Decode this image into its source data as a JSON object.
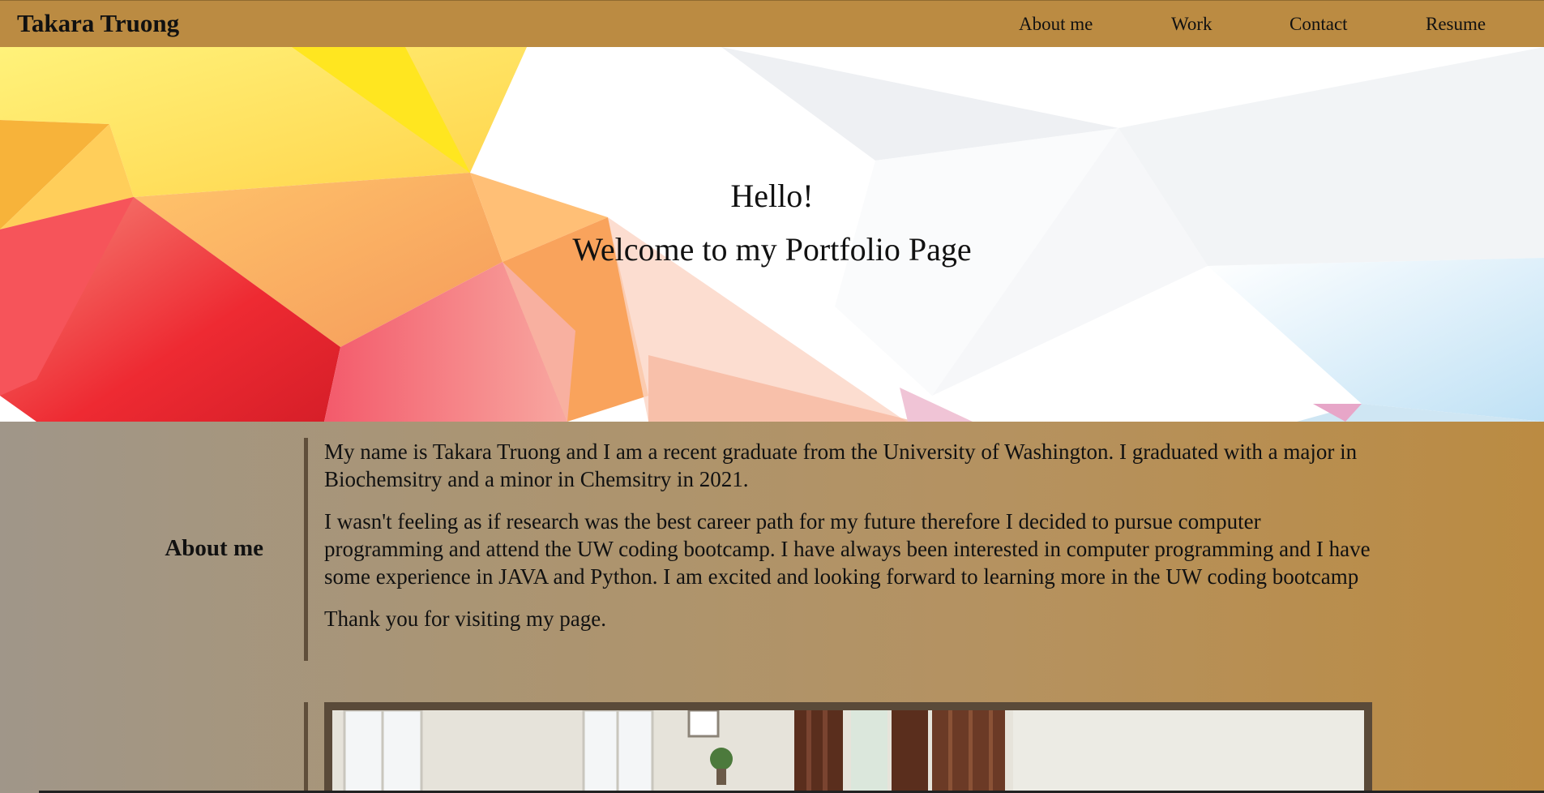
{
  "header": {
    "title": "Takara Truong",
    "nav": [
      {
        "label": "About me"
      },
      {
        "label": "Work"
      },
      {
        "label": "Contact"
      },
      {
        "label": "Resume"
      }
    ]
  },
  "hero": {
    "greeting": "Hello!",
    "subtitle": "Welcome to my Portfolio Page"
  },
  "about": {
    "heading": "About me",
    "paragraphs": [
      "My name is Takara Truong and I am a recent graduate from the University of Washington. I graduated with a major in Biochemsitry and a minor in Chemsitry in 2021.",
      "I wasn't feeling as if research was the best career path for my future therefore I decided to pursue computer programming and attend the UW coding bootcamp. I have always been interested in computer programming and I have some experience in JAVA and Python. I am excited and looking forward to learning more in the UW coding bootcamp",
      "Thank you for visiting my page."
    ]
  },
  "colors": {
    "header_bg": "#bb8b42",
    "accent_rule": "#5f4e3a",
    "frame": "#5a4a39"
  }
}
